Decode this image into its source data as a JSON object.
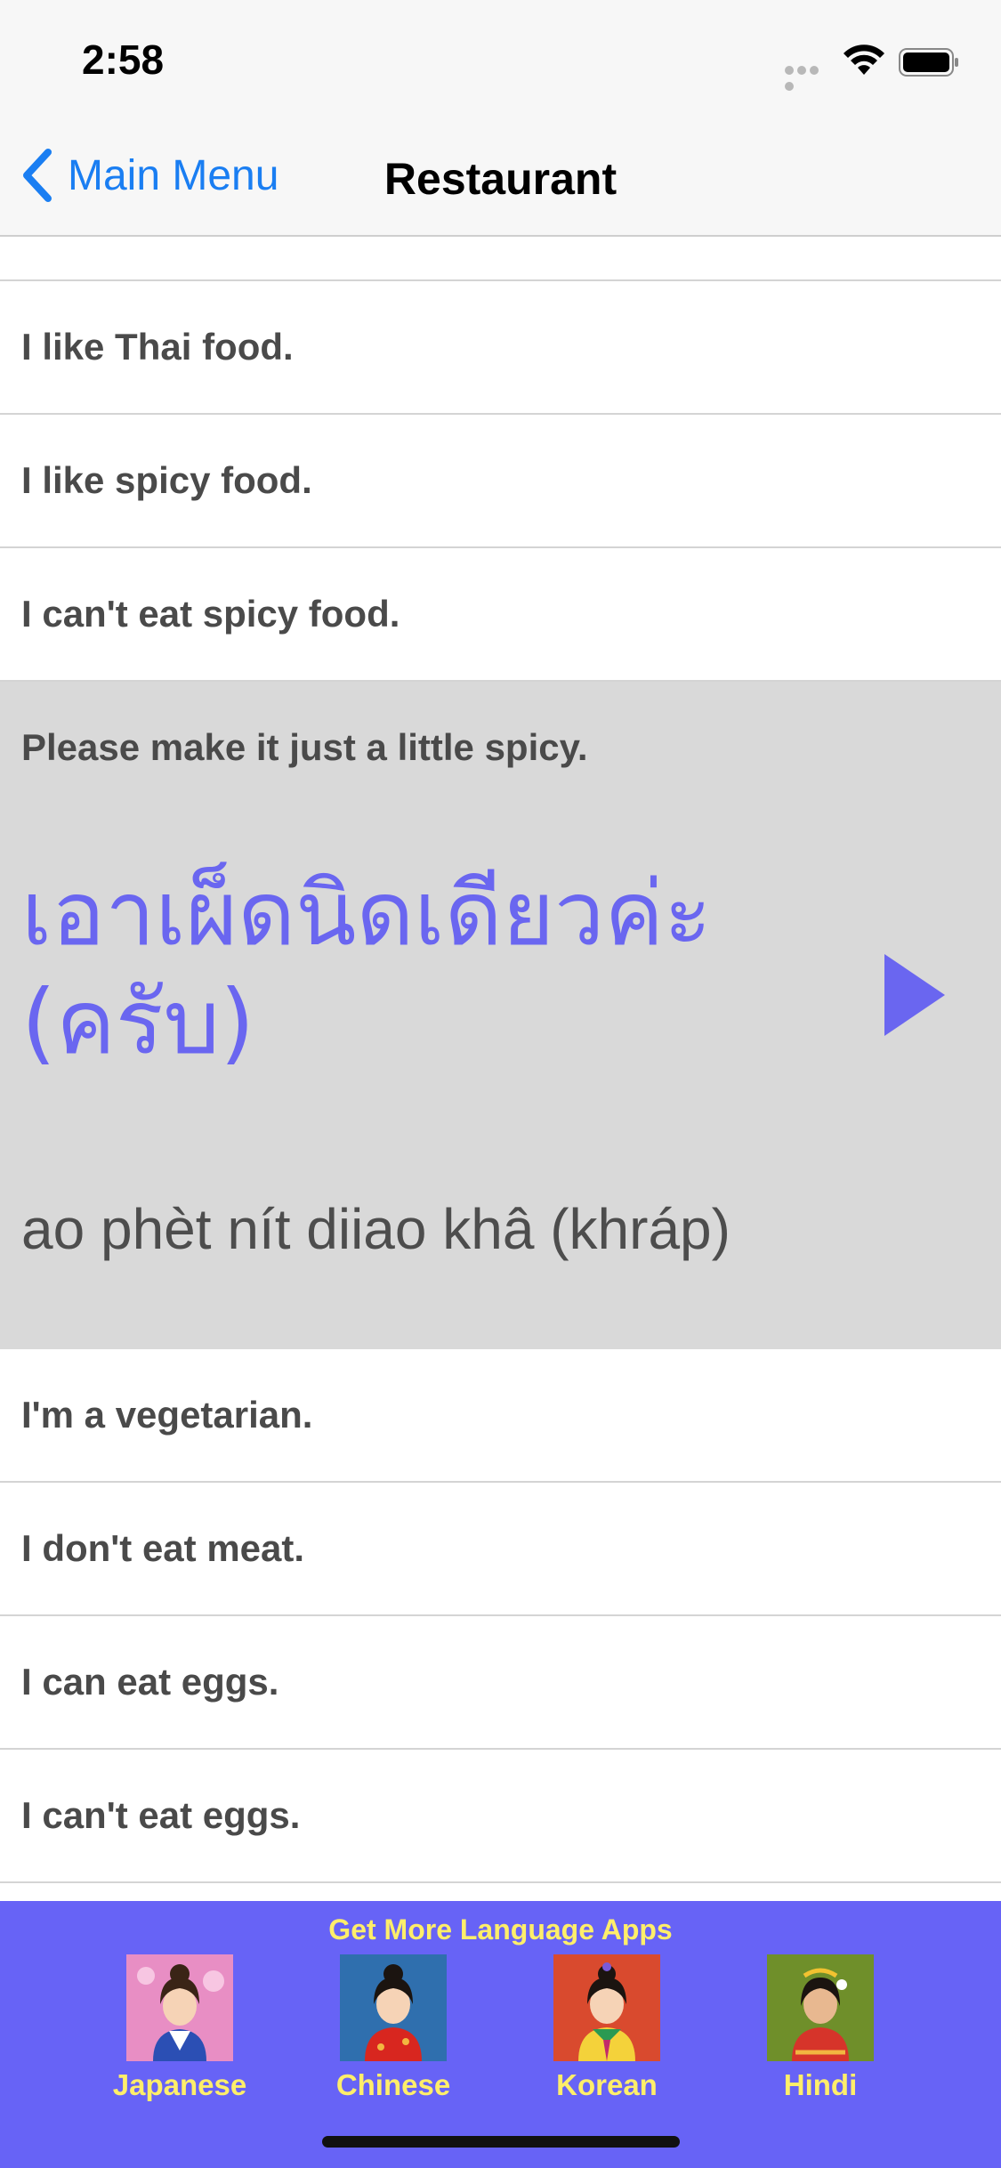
{
  "status_bar": {
    "time": "2:58"
  },
  "nav": {
    "back_label": "Main Menu",
    "title": "Restaurant"
  },
  "phrases_before": [
    {
      "label": "I like Thai food."
    },
    {
      "label": "I like spicy food."
    },
    {
      "label": "I can't eat spicy food."
    }
  ],
  "expanded": {
    "english": "Please make it just a little spicy.",
    "thai": "เอาเผ็ดนิดเดียวค่ะ (ครับ)",
    "romanization": "ao phèt nít diiao khâ (khráp)"
  },
  "phrases_after": [
    {
      "label": "I'm a vegetarian."
    },
    {
      "label": "I don't eat meat."
    },
    {
      "label": "I can eat eggs."
    },
    {
      "label": "I can't eat eggs."
    }
  ],
  "promo": {
    "title": "Get More Language Apps",
    "apps": [
      {
        "label": "Japanese",
        "bg": "#e88ec4"
      },
      {
        "label": "Chinese",
        "bg": "#2f6fae"
      },
      {
        "label": "Korean",
        "bg": "#d94a2e"
      },
      {
        "label": "Hindi",
        "bg": "#6f8f2a"
      }
    ]
  },
  "colors": {
    "accent": "#1a7ef2",
    "thai_text": "#6a66f0",
    "promo_bg": "#6763f6",
    "promo_text": "#ffee6a",
    "expanded_bg": "#d9d9d9"
  },
  "icons": {
    "back": "chevron-left-icon",
    "play": "play-icon",
    "wifi": "wifi-icon",
    "battery": "battery-icon",
    "signal": "signal-dots-icon"
  }
}
